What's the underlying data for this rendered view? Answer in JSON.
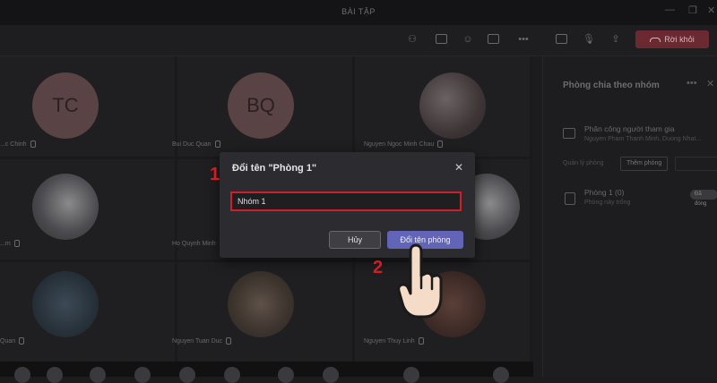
{
  "window": {
    "title": "BÀI TẬP",
    "controls": [
      "—",
      "❐",
      "✕"
    ]
  },
  "toolbar": {
    "leave_label": "Rời khỏi"
  },
  "participants": [
    {
      "name": "...c Chinh",
      "initials": "",
      "avatar": "photo-none"
    },
    {
      "name": "Bui Duc Quan",
      "initials": "BQ",
      "avatar": "initials"
    },
    {
      "name": "Nguyen Ngoc Minh Chau",
      "initials": "",
      "avatar": "photo"
    },
    {
      "name": "...m",
      "initials": "",
      "avatar": "photo"
    },
    {
      "name": "Ho Quynh Minh",
      "initials": "",
      "avatar": "photo"
    },
    {
      "name": "...",
      "initials": "",
      "avatar": "photo"
    },
    {
      "name": "Quan",
      "initials": "",
      "avatar": "photo"
    },
    {
      "name": "Nguyen Tuan Duc",
      "initials": "",
      "avatar": "photo"
    },
    {
      "name": "Nguyen Thuy Linh",
      "initials": "",
      "avatar": "photo"
    }
  ],
  "tc_initials": "TC",
  "panel": {
    "title": "Phòng chia theo nhóm",
    "assign_title": "Phân công người tham gia",
    "assign_sub": "Nguyen Pham Thanh Minh, Duong Nhat...",
    "rooms_label": "Quản lý phòng",
    "add_room": "Thêm phòng",
    "room_name": "Phòng 1 (0)",
    "room_sub": "Phòng này trống",
    "room_badge": "Đã đóng"
  },
  "dialog": {
    "title": "Đổi tên \"Phòng 1\"",
    "input_value": "Nhóm 1",
    "cancel_label": "Hủy",
    "rename_label": "Đổi tên phòng"
  },
  "annotations": {
    "step1": "1",
    "step2": "2"
  },
  "colors": {
    "leave": "#6b2a32",
    "primary": "#6265b7",
    "highlight": "#d01f2a"
  }
}
